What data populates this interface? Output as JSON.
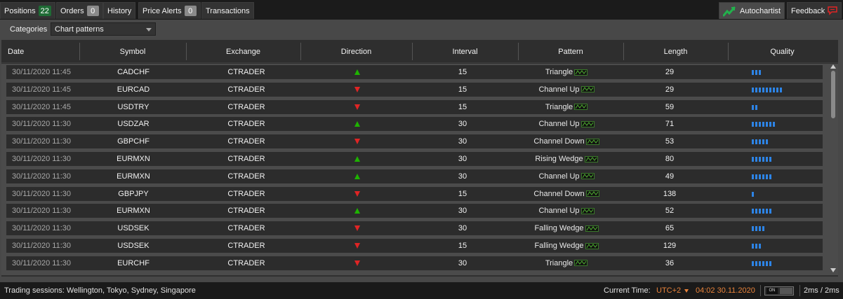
{
  "tabs": [
    {
      "label": "Positions",
      "badge": "22"
    },
    {
      "label": "Orders",
      "badge": "0"
    },
    {
      "label": "History"
    },
    {
      "label": "Price Alerts",
      "badge": "0"
    },
    {
      "label": "Transactions"
    }
  ],
  "right_tabs": {
    "autochartist": "Autochartist",
    "feedback": "Feedback"
  },
  "categories": {
    "label": "Categories",
    "selected": "Chart patterns"
  },
  "columns": [
    "Date",
    "Symbol",
    "Exchange",
    "Direction",
    "Interval",
    "Pattern",
    "Length",
    "Quality"
  ],
  "rows": [
    {
      "date": "30/11/2020 11:45",
      "symbol": "CADCHF",
      "exchange": "CTRADER",
      "direction": "up",
      "interval": "15",
      "pattern": "Triangle",
      "length": "29",
      "quality": 3
    },
    {
      "date": "30/11/2020 11:45",
      "symbol": "EURCAD",
      "exchange": "CTRADER",
      "direction": "down",
      "interval": "15",
      "pattern": "Channel Up",
      "length": "29",
      "quality": 9
    },
    {
      "date": "30/11/2020 11:45",
      "symbol": "USDTRY",
      "exchange": "CTRADER",
      "direction": "down",
      "interval": "15",
      "pattern": "Triangle",
      "length": "59",
      "quality": 2
    },
    {
      "date": "30/11/2020 11:30",
      "symbol": "USDZAR",
      "exchange": "CTRADER",
      "direction": "up",
      "interval": "30",
      "pattern": "Channel Up",
      "length": "71",
      "quality": 7
    },
    {
      "date": "30/11/2020 11:30",
      "symbol": "GBPCHF",
      "exchange": "CTRADER",
      "direction": "down",
      "interval": "30",
      "pattern": "Channel Down",
      "length": "53",
      "quality": 5
    },
    {
      "date": "30/11/2020 11:30",
      "symbol": "EURMXN",
      "exchange": "CTRADER",
      "direction": "up",
      "interval": "30",
      "pattern": "Rising Wedge",
      "length": "80",
      "quality": 6
    },
    {
      "date": "30/11/2020 11:30",
      "symbol": "EURMXN",
      "exchange": "CTRADER",
      "direction": "up",
      "interval": "30",
      "pattern": "Channel Up",
      "length": "49",
      "quality": 6
    },
    {
      "date": "30/11/2020 11:30",
      "symbol": "GBPJPY",
      "exchange": "CTRADER",
      "direction": "down",
      "interval": "15",
      "pattern": "Channel Down",
      "length": "138",
      "quality": 1
    },
    {
      "date": "30/11/2020 11:30",
      "symbol": "EURMXN",
      "exchange": "CTRADER",
      "direction": "up",
      "interval": "30",
      "pattern": "Channel Up",
      "length": "52",
      "quality": 6
    },
    {
      "date": "30/11/2020 11:30",
      "symbol": "USDSEK",
      "exchange": "CTRADER",
      "direction": "down",
      "interval": "30",
      "pattern": "Falling Wedge",
      "length": "65",
      "quality": 4
    },
    {
      "date": "30/11/2020 11:30",
      "symbol": "USDSEK",
      "exchange": "CTRADER",
      "direction": "down",
      "interval": "15",
      "pattern": "Falling Wedge",
      "length": "129",
      "quality": 3
    },
    {
      "date": "30/11/2020 11:30",
      "symbol": "EURCHF",
      "exchange": "CTRADER",
      "direction": "down",
      "interval": "30",
      "pattern": "Triangle",
      "length": "36",
      "quality": 6
    }
  ],
  "status": {
    "sessions": "Trading sessions: Wellington, Tokyo, Sydney, Singapore",
    "current_time_label": "Current Time:",
    "timezone": "UTC+2",
    "time": "04:02 30.11.2020",
    "toggle": "ON",
    "latency": "2ms / 2ms"
  },
  "colors": {
    "up": "#1eb300",
    "down": "#e02424",
    "quality": "#2d84e6",
    "time": "#e8823a",
    "badge_green": "#1f6b35"
  },
  "icons": {
    "autochartist": "autochartist-logo-icon",
    "feedback": "speech-bubble-icon",
    "pattern": "pattern-thumbnail-icon"
  }
}
